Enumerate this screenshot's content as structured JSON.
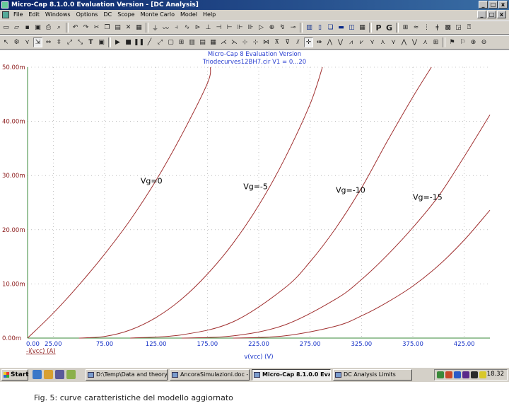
{
  "window": {
    "title": "Micro-Cap 8.1.0.0 Evaluation Version - [DC Analysis]",
    "caption_buttons": [
      "_",
      "□",
      "x"
    ],
    "mdi_buttons": [
      "_",
      "□",
      "x"
    ]
  },
  "menu": {
    "items": [
      "File",
      "Edit",
      "Windows",
      "Options",
      "DC",
      "Scope",
      "Monte Carlo",
      "Model",
      "Help"
    ]
  },
  "toolbar1": {
    "text_buttons": [
      "P",
      "G"
    ]
  },
  "toolbar2": {
    "text_buttons": [
      "T"
    ]
  },
  "plot": {
    "title": "Micro-Cap 8 Evaluation Version",
    "subtitle": "Triodecurves12BH7.cir V1 = 0...20"
  },
  "chart_data": {
    "type": "line",
    "title": "Micro-Cap 8 Evaluation Version",
    "subtitle": "Triodecurves12BH7.cir V1 = 0...20",
    "xlabel": "v(vcc) (V)",
    "ylabel": "-i(vcc) (A)",
    "xlim": [
      0,
      450
    ],
    "ylim": [
      0,
      0.05
    ],
    "x_ticks": [
      "0.00",
      "25.00",
      "75.00",
      "125.00",
      "175.00",
      "225.00",
      "275.00",
      "325.00",
      "375.00",
      "425.00"
    ],
    "y_ticks": [
      "0.00m",
      "10.00m",
      "20.00m",
      "30.00m",
      "40.00m",
      "50.00m"
    ],
    "grid": true,
    "series": [
      {
        "name": "Vg=0",
        "color": "#a03030",
        "x": [
          0,
          25,
          50,
          75,
          100,
          125,
          150,
          175,
          178
        ],
        "y": [
          0,
          0.0046,
          0.0098,
          0.0155,
          0.0218,
          0.0291,
          0.0375,
          0.047,
          0.05
        ]
      },
      {
        "name": "Vg=-5",
        "color": "#a03030",
        "x": [
          50,
          75,
          100,
          125,
          150,
          175,
          200,
          225,
          250,
          275,
          287
        ],
        "y": [
          0,
          0.0003,
          0.0015,
          0.0038,
          0.0072,
          0.0118,
          0.0175,
          0.0245,
          0.033,
          0.0432,
          0.05
        ]
      },
      {
        "name": "Vg=-10",
        "color": "#a03030",
        "x": [
          100,
          150,
          200,
          250,
          275,
          300,
          325,
          350,
          375,
          393
        ],
        "y": [
          0,
          0.0006,
          0.003,
          0.0092,
          0.0141,
          0.0203,
          0.0277,
          0.0363,
          0.0445,
          0.05
        ]
      },
      {
        "name": "Vg=-15",
        "color": "#a03030",
        "x": [
          150,
          200,
          250,
          300,
          325,
          350,
          375,
          400,
          425,
          450
        ],
        "y": [
          0,
          0.0004,
          0.0024,
          0.0072,
          0.0108,
          0.0153,
          0.0204,
          0.0262,
          0.0335,
          0.0412
        ]
      },
      {
        "name": "",
        "color": "#a03030",
        "x": [
          200,
          250,
          300,
          325,
          350,
          375,
          400,
          425,
          450
        ],
        "y": [
          0,
          0.0004,
          0.0022,
          0.0041,
          0.0066,
          0.0096,
          0.0134,
          0.0181,
          0.0236
        ]
      }
    ],
    "curve_labels": [
      {
        "text": "Vg=0",
        "x": 110,
        "y": 0.0285
      },
      {
        "text": "Vg=-5",
        "x": 210,
        "y": 0.0275
      },
      {
        "text": "Vg=-10",
        "x": 300,
        "y": 0.0268
      },
      {
        "text": "Vg=-15",
        "x": 375,
        "y": 0.0255
      }
    ]
  },
  "taskbar": {
    "start_label": "Start",
    "tasks": [
      {
        "label": "D:\\Temp\\Data and theory....",
        "active": false
      },
      {
        "label": "AncoraSimulazioni.doc - M...",
        "active": false
      },
      {
        "label": "Micro-Cap 8.1.0.0 Eval...",
        "active": true
      },
      {
        "label": "DC Analysis Limits",
        "active": false
      }
    ],
    "clock": "18.32"
  },
  "caption": "Fig. 5: curve caratteristiche del modello aggiornato"
}
